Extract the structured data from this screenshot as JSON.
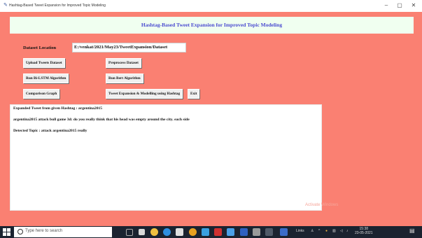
{
  "window": {
    "title": "Hashtag-Based Tweet Expansion for Improved Topic Modeling",
    "minimize": "–",
    "maximize": "▢",
    "close": "✕"
  },
  "app": {
    "header": "Hashtag-Based Tweet Expansion for Improved Topic Modeling",
    "dataset_label": "Dataset Location",
    "dataset_path": "E:/venkat/2021/May23/TweetExpansion/Dataset",
    "buttons": {
      "upload": "Upload Tweets Dataset",
      "preprocess": "Preprocess Dataset",
      "bilstm": "Run Bi-LSTM Algorithm",
      "bert": "Run Bert Algorithm",
      "comparison": "Comparison Graph",
      "expansion": "Tweet Expansion & Modelling using Hashtag",
      "exit": "Exit"
    },
    "output": {
      "line1": "Expanded Tweet from given Hashtag : argentina2015",
      "line2": "argentina2015  attack bull game 3d: do you really think that his head was empty around the city. each side",
      "line3": "Detected Topic  : attack argentina2015 really"
    },
    "watermark": "Activate Windows"
  },
  "taskbar": {
    "search_placeholder": "Type here to search",
    "links": "Links",
    "time": "15:38",
    "date": "23-05-2021",
    "icons": [
      "task-view-icon",
      "file-explorer-icon",
      "browser-icon",
      "edge-icon",
      "store-icon",
      "chrome-icon",
      "mail-icon",
      "acrobat-icon",
      "notepad-icon",
      "python-icon",
      "settings-icon",
      "terminal-icon",
      "app-icon"
    ]
  },
  "colors": {
    "app_background": "#fa8072",
    "header_background": "#f0fff0",
    "header_text": "#4a4ad0",
    "taskbar": "#1b2330"
  }
}
